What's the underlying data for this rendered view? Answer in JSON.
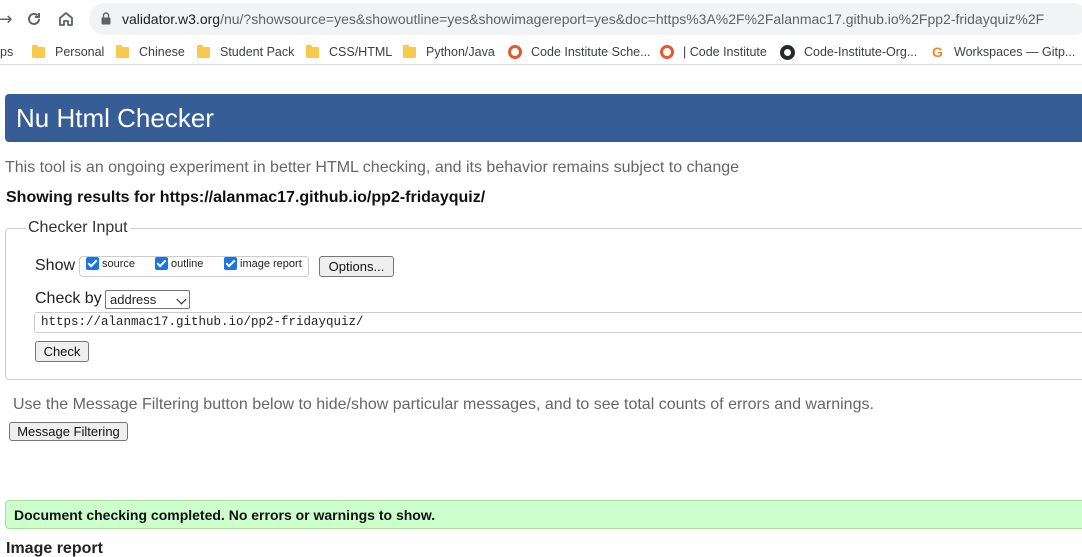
{
  "browser": {
    "url_host": "validator.w3.org",
    "url_rest": "/nu/?showsource=yes&showoutline=yes&showimagereport=yes&doc=https%3A%2F%2Falanmac17.github.io%2Fpp2-fridayquiz%2F",
    "back_icon": "arrow-right-icon",
    "reload_icon": "reload-icon",
    "home_icon": "home-icon"
  },
  "bookmarks": [
    {
      "label": "ps",
      "icon": "none"
    },
    {
      "label": "Personal",
      "icon": "folder-icon"
    },
    {
      "label": "Chinese",
      "icon": "folder-icon"
    },
    {
      "label": "Student Pack",
      "icon": "folder-icon"
    },
    {
      "label": "CSS/HTML",
      "icon": "folder-icon"
    },
    {
      "label": "Python/Java",
      "icon": "folder-icon"
    },
    {
      "label": "Code Institute Sche...",
      "icon": "code-institute-icon"
    },
    {
      "label": "| Code Institute",
      "icon": "code-institute-icon"
    },
    {
      "label": "Code-Institute-Org...",
      "icon": "github-icon"
    },
    {
      "label": "Workspaces — Gitp...",
      "icon": "gitpod-icon"
    }
  ],
  "checker": {
    "title": "Nu Html Checker",
    "tagline": "This tool is an ongoing experiment in better HTML checking, and its behavior remains subject to change",
    "results_for": "Showing results for https://alanmac17.github.io/pp2-fridayquiz/",
    "input_legend": "Checker Input",
    "show_label": "Show",
    "show_options": [
      {
        "label": "source",
        "checked": true
      },
      {
        "label": "outline",
        "checked": true
      },
      {
        "label": "image report",
        "checked": true
      }
    ],
    "options_button": "Options...",
    "check_by_label": "Check by",
    "check_by_value": "address",
    "address_value": "https://alanmac17.github.io/pp2-fridayquiz/",
    "check_button": "Check",
    "filter_note": "Use the Message Filtering button below to hide/show particular messages, and to see total counts of errors and warnings.",
    "filter_button": "Message Filtering",
    "success_message": "Document checking completed. No errors or warnings to show.",
    "image_report_heading": "Image report"
  },
  "colors": {
    "header_bg": "#365d95",
    "success_bg": "#ccffcc",
    "checkbox": "#1a73e8"
  }
}
